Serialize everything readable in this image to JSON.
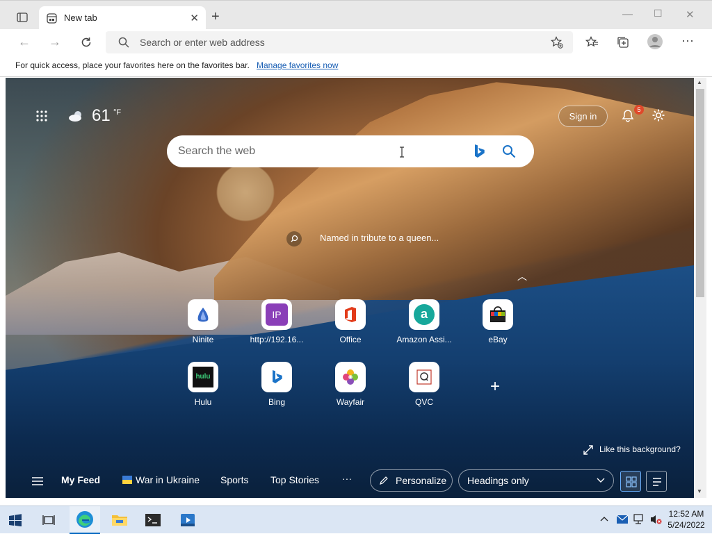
{
  "browser": {
    "tab_title": "New tab",
    "address_placeholder": "Search or enter web address",
    "favorites_message": "For quick access, place your favorites here on the favorites bar.",
    "favorites_link": "Manage favorites now"
  },
  "newtab": {
    "temperature": "61",
    "temp_unit": "°F",
    "search_placeholder": "Search the web",
    "signin_label": "Sign in",
    "notification_count": "5",
    "background_caption": "Named in tribute to a queen...",
    "like_background": "Like this background?",
    "quick_links": [
      {
        "label": "Ninite"
      },
      {
        "label": "http://192.16..."
      },
      {
        "label": "Office"
      },
      {
        "label": "Amazon Assi..."
      },
      {
        "label": "eBay"
      },
      {
        "label": "Hulu"
      },
      {
        "label": "Bing"
      },
      {
        "label": "Wayfair"
      },
      {
        "label": "QVC"
      }
    ],
    "feed": {
      "items": [
        "My Feed",
        "War in Ukraine",
        "Sports",
        "Top Stories"
      ],
      "more": "···",
      "personalize": "Personalize",
      "layout_option": "Headings only"
    }
  },
  "taskbar": {
    "time": "12:52 AM",
    "date": "5/24/2022"
  },
  "colors": {
    "accent": "#0067c0",
    "link": "#1a5fb4",
    "badge": "#e0482a",
    "taskbar": "#dbe6f4"
  }
}
